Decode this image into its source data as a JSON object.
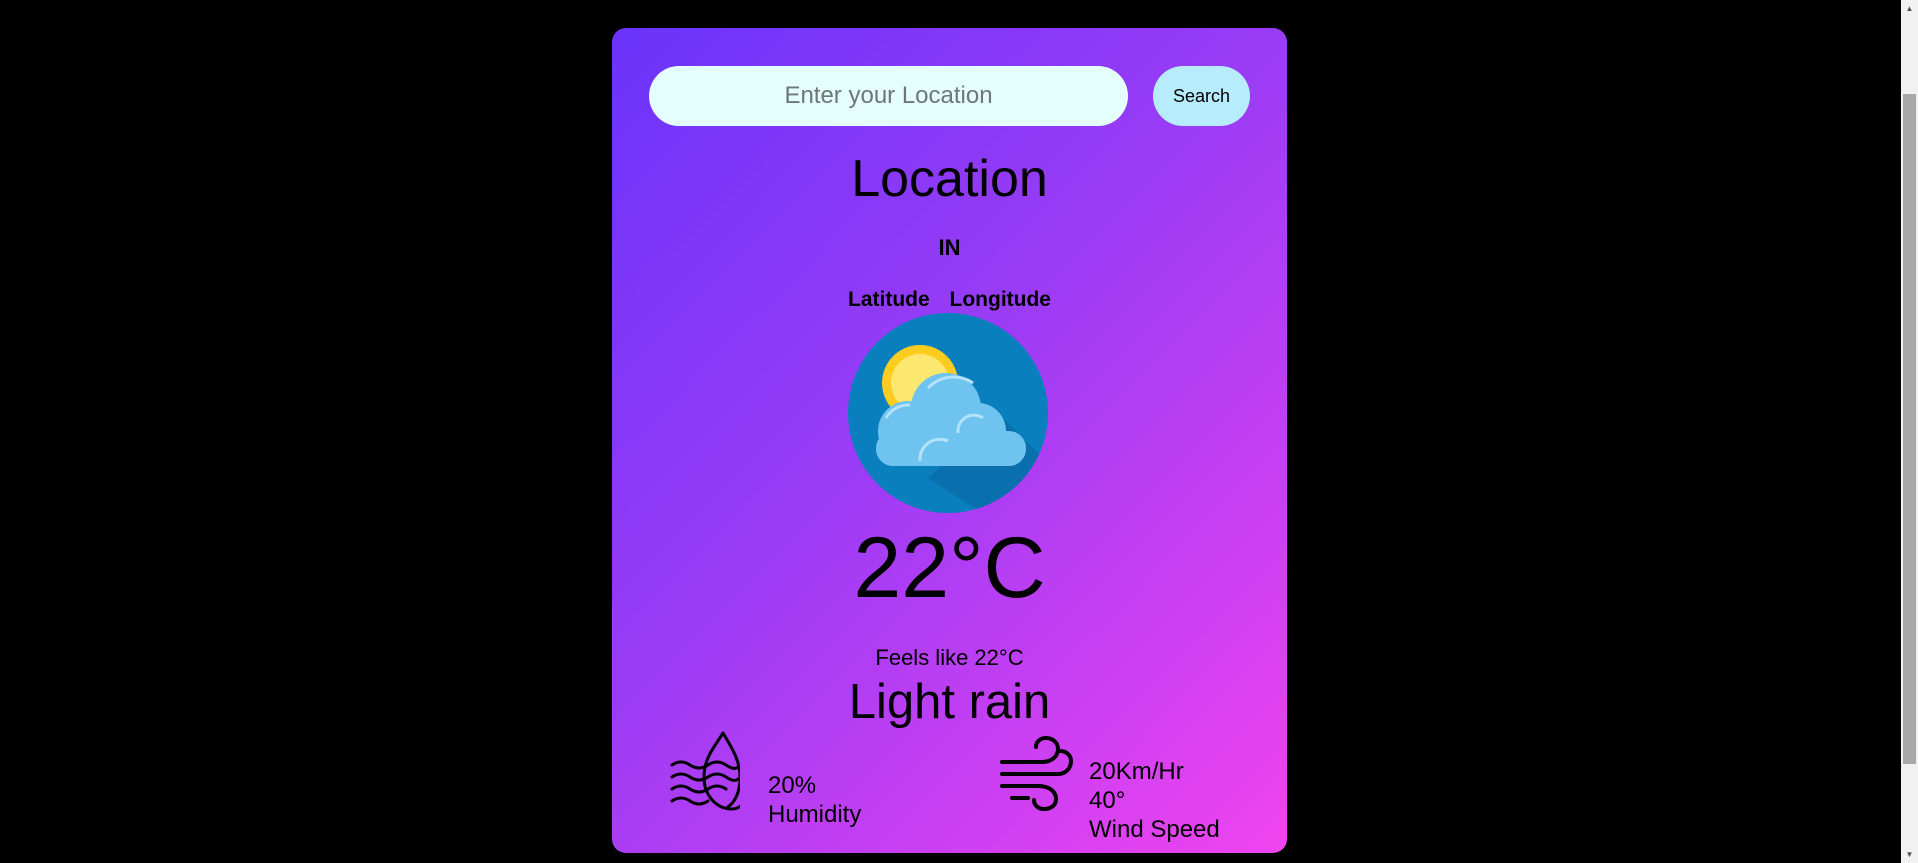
{
  "search": {
    "placeholder": "Enter your Location",
    "value": "",
    "button_label": "Search"
  },
  "location": {
    "name": "Location",
    "country": "IN",
    "latitude_label": "Latitude",
    "longitude_label": "Longitude"
  },
  "weather": {
    "icon": "partly-cloudy-icon",
    "temperature": "22°C",
    "feels_like": "Feels like 22°C",
    "description": "Light rain"
  },
  "humidity": {
    "icon": "humidity-icon",
    "value": "20%",
    "label": "Humidity"
  },
  "wind": {
    "icon": "wind-icon",
    "speed": "20Km/Hr",
    "direction": "40°",
    "label": "Wind Speed"
  },
  "colors": {
    "page_background": "#000000",
    "card_gradient_start": "#6a33fb",
    "card_gradient_end": "#f044ef",
    "input_background": "#e4fdfd",
    "button_background": "#b6ecfb",
    "icon_circle": "#0a7fbd",
    "sun": "#fccd1f",
    "cloud": "#6ec3ef"
  }
}
